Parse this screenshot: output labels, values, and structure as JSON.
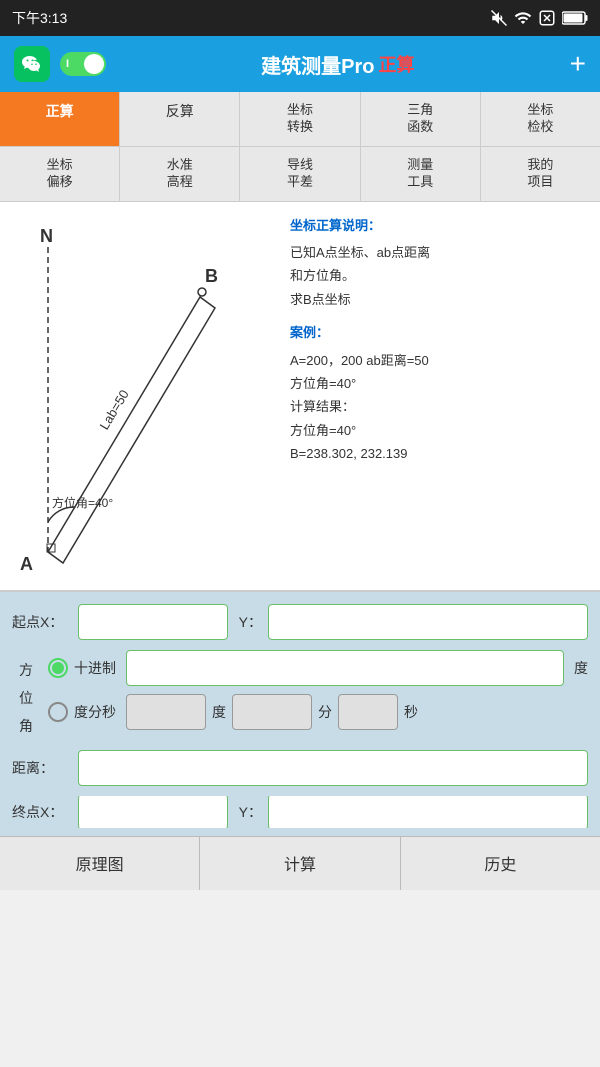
{
  "statusBar": {
    "time": "下午3:13",
    "icons": [
      "mute",
      "wifi",
      "close",
      "battery"
    ]
  },
  "header": {
    "title": "建筑测量Pro",
    "subtitle": "正算",
    "plus": "+",
    "toggle_label": "I"
  },
  "nav_row1": [
    {
      "label": "正算",
      "active": true
    },
    {
      "label": "反算",
      "active": false
    },
    {
      "label": "坐标\n转换",
      "active": false
    },
    {
      "label": "三角\n函数",
      "active": false
    },
    {
      "label": "坐标\n检校",
      "active": false
    }
  ],
  "nav_row2": [
    {
      "label": "坐标\n偏移",
      "active": false
    },
    {
      "label": "水准\n高程",
      "active": false
    },
    {
      "label": "导线\n平差",
      "active": false
    },
    {
      "label": "测量\n工具",
      "active": false
    },
    {
      "label": "我的\n项目",
      "active": false
    }
  ],
  "diagram": {
    "label_lab": "Lab=50",
    "label_fangwei": "方位角=40°",
    "point_a": "A",
    "point_b": "B",
    "point_n": "N"
  },
  "description": {
    "title": "坐标正算说明：",
    "body": "已知A点坐标、ab点距离\n和方位角。\n求B点坐标",
    "case_title": "案例：",
    "case_lines": [
      "A=200，200 ab距离=50",
      "方位角=40°",
      "计算结果：",
      "方位角=40°",
      "B=238.302, 232.139"
    ]
  },
  "form": {
    "qidian_label": "起点X：",
    "y_label": "Y：",
    "fangwei_label_chars": [
      "方",
      "位",
      "角"
    ],
    "jinjin_label": "十进制",
    "fenfen_label": "度分秒",
    "du_label": "度",
    "fen_label": "分",
    "miao_label": "秒",
    "du_unit": "度",
    "juli_label": "距离：",
    "zhongdian_label": "终点X：",
    "zhongdian_y_label": "Y："
  },
  "toolbar": {
    "yuanli": "原理图",
    "jisuan": "计算",
    "lishi": "历史"
  }
}
